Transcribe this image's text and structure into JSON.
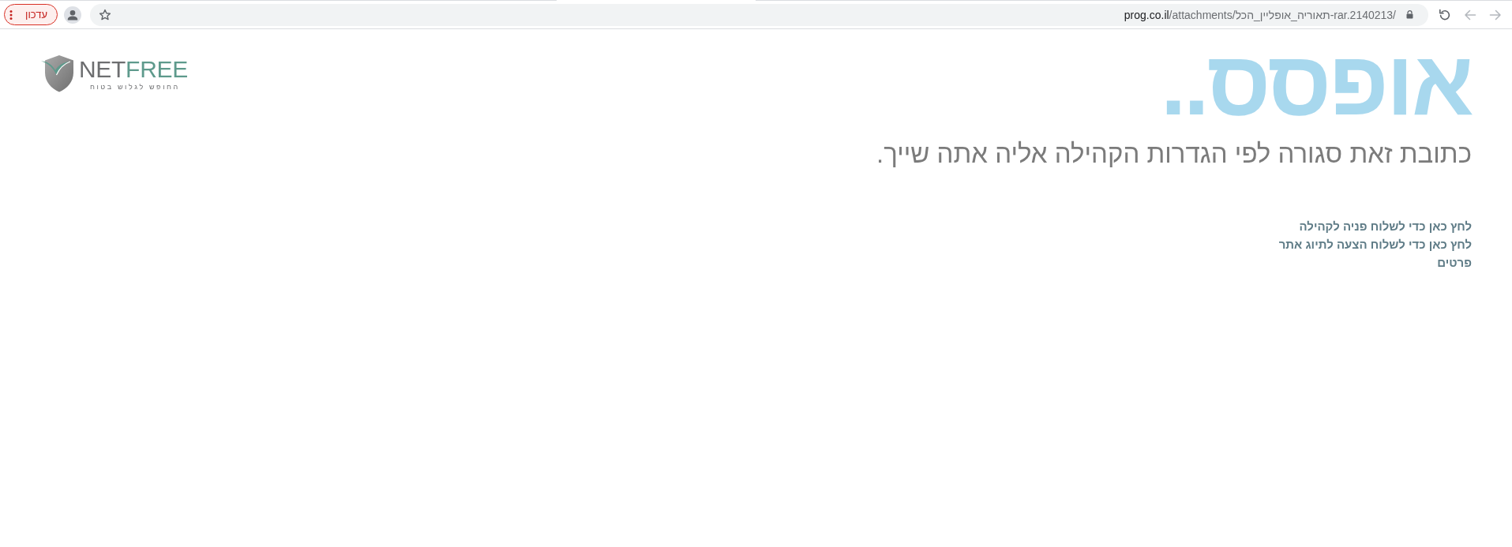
{
  "browser_toolbar": {
    "update_button": {
      "label": "עדכון"
    },
    "address_bar": {
      "url_host": "prog.co.il",
      "url_path": "/attachments/תאוריה_אופליין_הכל-rar.2140213/"
    },
    "back_button": {
      "disabled": true
    },
    "forward_button": {
      "disabled": true
    }
  },
  "logo": {
    "wordmark_dark": "NET",
    "wordmark_light": "FREE",
    "tagline": "החופש לגלוש בטוח"
  },
  "page": {
    "title": "אופסס..",
    "message": "כתובת זאת סגורה לפי הגדרות הקהילה אליה אתה שייך.",
    "links": [
      "לחץ כאן כדי לשלוח פניה לקהילה",
      "לחץ כאן כדי לשלוח הצעה לתיוג אתר",
      "פרטים"
    ]
  }
}
